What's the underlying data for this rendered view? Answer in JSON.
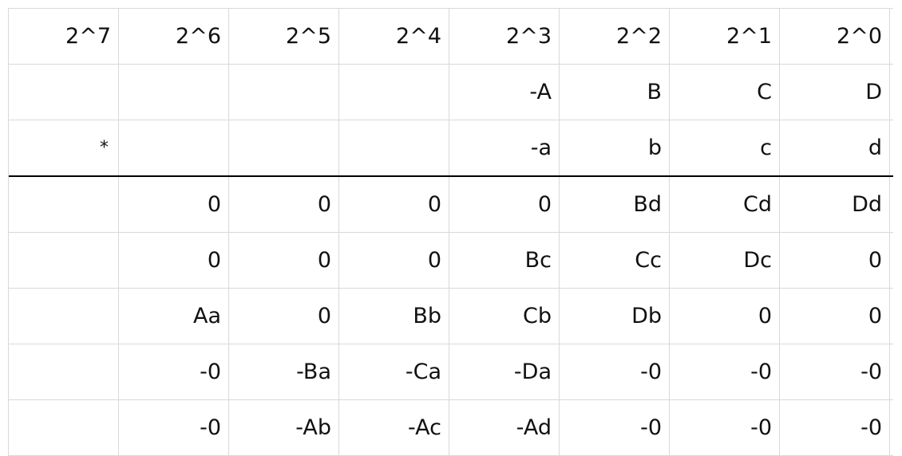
{
  "table": {
    "rows": [
      [
        "2^7",
        "2^6",
        "2^5",
        "2^4",
        "2^3",
        "2^2",
        "2^1",
        "2^0"
      ],
      [
        "",
        "",
        "",
        "",
        "-A",
        "B",
        "C",
        "D"
      ],
      [
        "*",
        "",
        "",
        "",
        "-a",
        "b",
        "c",
        "d"
      ],
      [
        "",
        "0",
        "0",
        "0",
        "0",
        "Bd",
        "Cd",
        "Dd"
      ],
      [
        "",
        "0",
        "0",
        "0",
        "Bc",
        "Cc",
        "Dc",
        "0"
      ],
      [
        "",
        "Aa",
        "0",
        "Bb",
        "Cb",
        "Db",
        "0",
        "0"
      ],
      [
        "",
        "-0",
        "-Ba",
        "-Ca",
        "-Da",
        "-0",
        "-0",
        "-0"
      ],
      [
        "",
        "-0",
        "-Ab",
        "-Ac",
        "-Ad",
        "-0",
        "-0",
        "-0"
      ]
    ]
  }
}
